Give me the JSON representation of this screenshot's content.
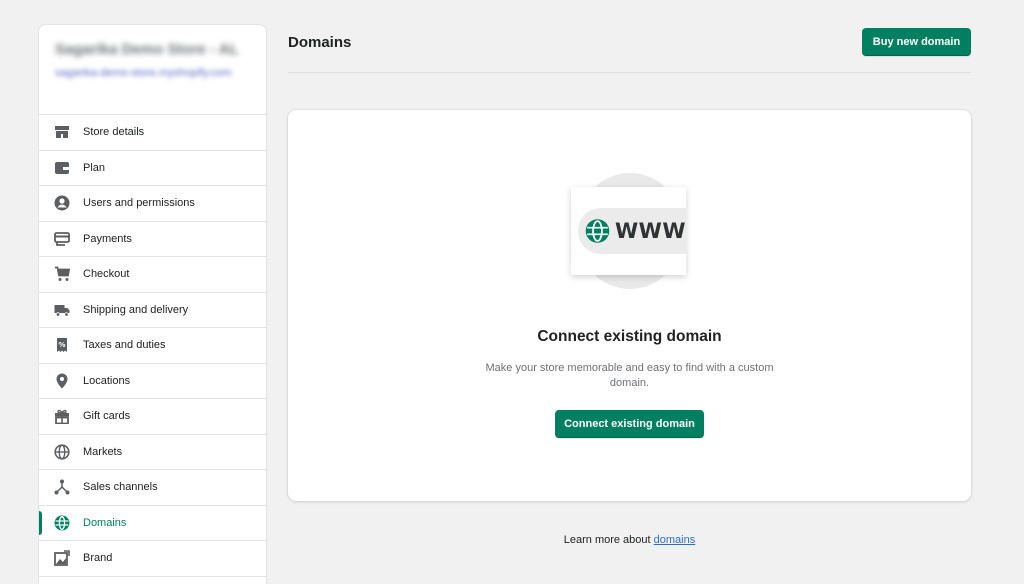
{
  "sidebar": {
    "store_name": "Sagarika Demo Store - AL",
    "store_url": "sagarika-demo-store.myshopify.com",
    "items": [
      {
        "label": "Store details",
        "icon": "store-icon"
      },
      {
        "label": "Plan",
        "icon": "wallet-icon"
      },
      {
        "label": "Users and permissions",
        "icon": "user-icon"
      },
      {
        "label": "Payments",
        "icon": "credit-card-icon"
      },
      {
        "label": "Checkout",
        "icon": "cart-icon"
      },
      {
        "label": "Shipping and delivery",
        "icon": "truck-icon"
      },
      {
        "label": "Taxes and duties",
        "icon": "tax-receipt-icon"
      },
      {
        "label": "Locations",
        "icon": "location-pin-icon"
      },
      {
        "label": "Gift cards",
        "icon": "gift-icon"
      },
      {
        "label": "Markets",
        "icon": "globe-outline-icon"
      },
      {
        "label": "Sales channels",
        "icon": "channels-icon"
      },
      {
        "label": "Domains",
        "icon": "globe-icon",
        "active": true
      },
      {
        "label": "Brand",
        "icon": "brand-image-icon"
      }
    ]
  },
  "header": {
    "title": "Domains",
    "buy_button_label": "Buy new domain"
  },
  "empty_state": {
    "illustration_text": "WWW",
    "title": "Connect existing domain",
    "description": "Make your store memorable and easy to find with a custom domain.",
    "button_label": "Connect existing domain"
  },
  "footer": {
    "learn_more_prefix": "Learn more about",
    "learn_more_link": "domains"
  },
  "colors": {
    "accent": "#008060",
    "link": "#2c6ecb",
    "background": "#f1f1f1"
  }
}
